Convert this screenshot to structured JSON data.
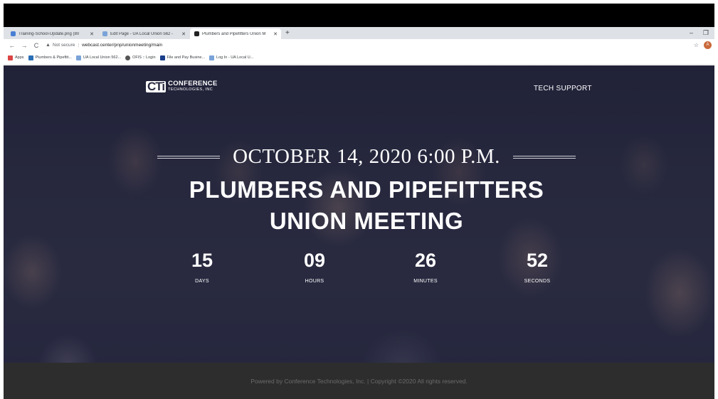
{
  "browser": {
    "tabs": [
      {
        "title": "Training-School-Update.png (80",
        "fav_color": "#4a7fd4"
      },
      {
        "title": "Edit Page - UA Local Union 562 - ",
        "fav_color": "#7aa3d8"
      },
      {
        "title": "Plumbers and Pipefitters Union M",
        "fav_color": "#222222",
        "active": true
      }
    ],
    "new_tab": "+",
    "security": "Not secure",
    "url": "webcast.center/pnp/unionmeeting/main",
    "avatar_initial": "A",
    "bookmarks": [
      {
        "label": "Apps",
        "color": "#d44"
      },
      {
        "label": "Plumbers & Pipefitt...",
        "color": "#2a6fb5"
      },
      {
        "label": "UA Local Union 562...",
        "color": "#7aa3d8"
      },
      {
        "label": "OFIS :: Login",
        "color": "#555"
      },
      {
        "label": "File and Pay Busine...",
        "color": "#1a3f8a"
      },
      {
        "label": "Log In - UA Local U...",
        "color": "#7aa3d8"
      }
    ]
  },
  "site": {
    "logo_mark": "CTi",
    "logo_line1": "CONFERENCE",
    "logo_line2": "TECHNOLOGIES, INC",
    "tech_support": "TECH SUPPORT",
    "date": "OCTOBER 14, 2020 6:00 P.M.",
    "title_line1": "PLUMBERS AND PIPEFITTERS",
    "title_line2": "UNION MEETING",
    "countdown": [
      {
        "value": "15",
        "label": "DAYS"
      },
      {
        "value": "09",
        "label": "HOURS"
      },
      {
        "value": "26",
        "label": "MINUTES"
      },
      {
        "value": "52",
        "label": "SECONDS"
      }
    ],
    "footer": "Powered by Conference Technologies, Inc. | Copyright ©2020 All rights reserved."
  }
}
